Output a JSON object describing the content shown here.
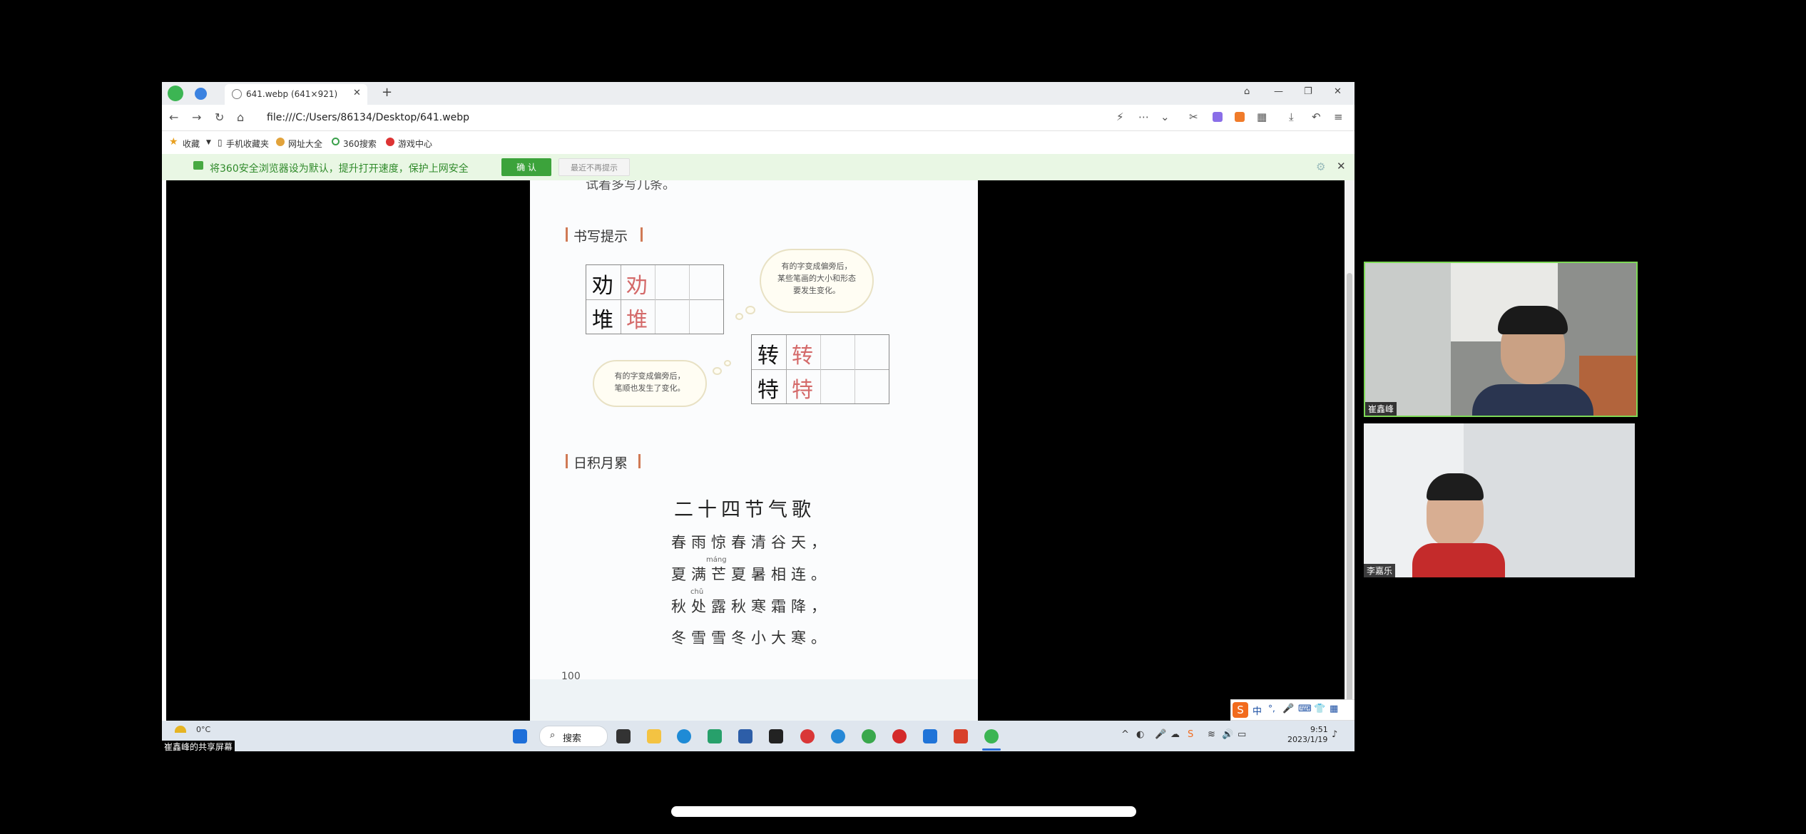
{
  "browser": {
    "tab_title": "641.webp (641×921)",
    "address": "file:///C:/Users/86134/Desktop/641.webp",
    "bookmarks": [
      "收藏",
      "手机收藏夹",
      "网址大全",
      "360搜索",
      "游戏中心"
    ],
    "notification": {
      "message": "将360安全浏览器设为默认，提升打开速度，保护上网安全",
      "confirm": "确 认",
      "dismiss": "最近不再提示"
    }
  },
  "textbook": {
    "top_cut_text": "试着多写几条。",
    "section_writing": "书写提示",
    "grid1_chars": [
      "劝",
      "堆"
    ],
    "grid2_chars": [
      "转",
      "特"
    ],
    "cloud_top": [
      "有的字变成偏旁后，",
      "某些笔画的大小和形态",
      "要发生变化。"
    ],
    "cloud_bottom": [
      "有的字变成偏旁后，",
      "笔顺也发生了变化。"
    ],
    "section_accumulate": "日积月累",
    "poem_title": "二十四节气歌",
    "poem_lines": [
      "春雨惊春清谷天，",
      "夏满芒夏暑相连。",
      "秋处露秋寒霜降，",
      "冬雪雪冬小大寒。"
    ],
    "pinyin_mang": "máng",
    "pinyin_chu": "chǔ",
    "page_number": "100"
  },
  "taskbar": {
    "weather": "0°C",
    "search": "搜索",
    "time": "9:51",
    "date": "2023/1/19"
  },
  "share_label": "崔鑫峰的共享屏幕",
  "participants": [
    {
      "name": "崔鑫峰"
    },
    {
      "name": "李嘉乐"
    }
  ]
}
